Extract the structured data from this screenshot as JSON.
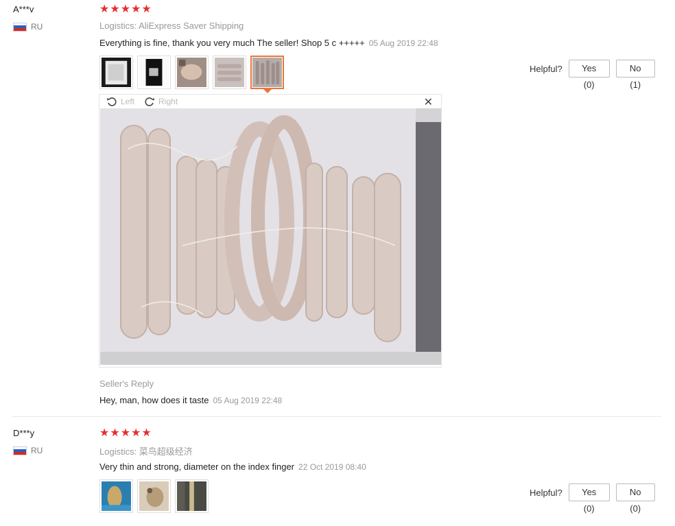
{
  "reviews": [
    {
      "buyer": "A***v",
      "country": "RU",
      "rating": 5,
      "logistics": "Logistics: AliExpress Saver Shipping",
      "text": "Everything is fine, thank you very much The seller! Shop 5 c +++++",
      "date": "05 Aug 2019 22:48",
      "helpful_label": "Helpful?",
      "yes_label": "Yes (0)",
      "no_label": "No (1)",
      "viewer": {
        "left_label": "Left",
        "right_label": "Right",
        "close_label": "✕"
      },
      "seller_reply_label": "Seller's Reply",
      "seller_reply": "Hey, man, how does it taste",
      "seller_reply_date": "05 Aug 2019 22:48"
    },
    {
      "buyer": "D***y",
      "country": "RU",
      "rating": 5,
      "logistics": "Logistics: 菜鸟超级经济",
      "text": "Very thin and strong, diameter on the index finger",
      "date": "22 Oct 2019 08:40",
      "helpful_label": "Helpful?",
      "yes_label": "Yes (0)",
      "no_label": "No (0)"
    }
  ],
  "colors": {
    "star": "#e62e2e",
    "active_thumb_border": "#e8763b",
    "muted_text": "#999999"
  },
  "icons": {
    "star": "star-icon",
    "rotate_left": "rotate-left-icon",
    "rotate_right": "rotate-right-icon",
    "close": "close-icon"
  }
}
